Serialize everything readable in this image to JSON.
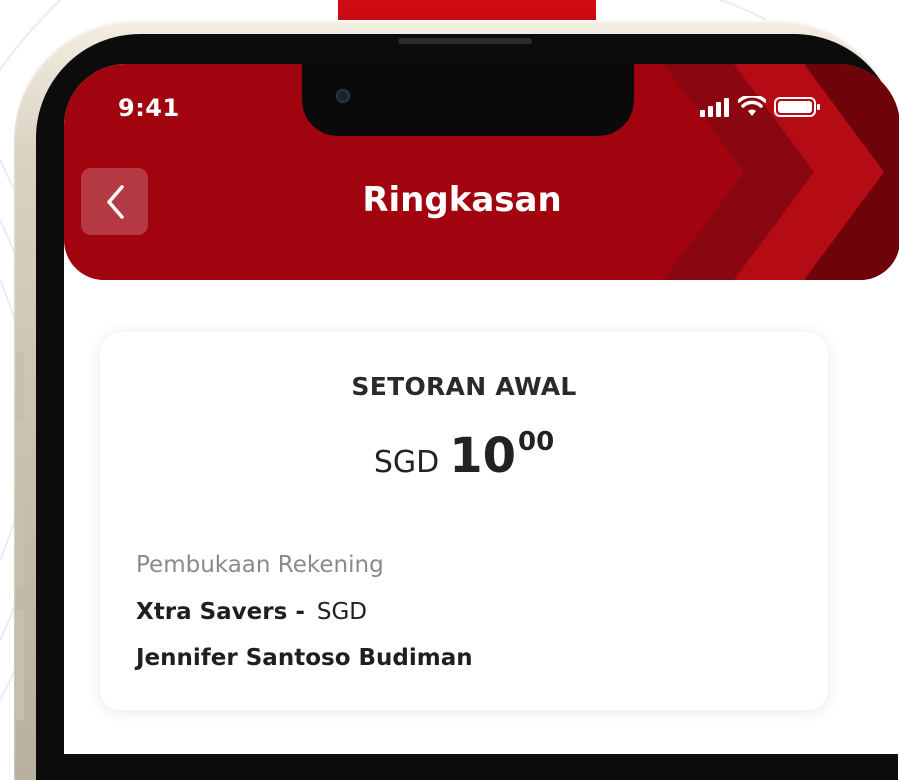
{
  "status_bar": {
    "time": "9:41",
    "icons": [
      "cellular-signal-icon",
      "wifi-icon",
      "battery-icon"
    ]
  },
  "header": {
    "title": "Ringkasan",
    "back_icon": "chevron-left-icon",
    "background_color": "#a1030f"
  },
  "summary": {
    "deposit_label": "SETORAN AWAL",
    "currency": "SGD",
    "amount_integer": "10",
    "amount_decimal": "00",
    "account_opening_label": "Pembukaan Rekening",
    "product_name": "Xtra Savers -",
    "product_currency": "SGD",
    "account_holder": "Jennifer Santoso Budiman"
  },
  "colors": {
    "brand_red": "#a1030f",
    "accent_red": "#e0101a",
    "card_bg": "#ffffff"
  }
}
